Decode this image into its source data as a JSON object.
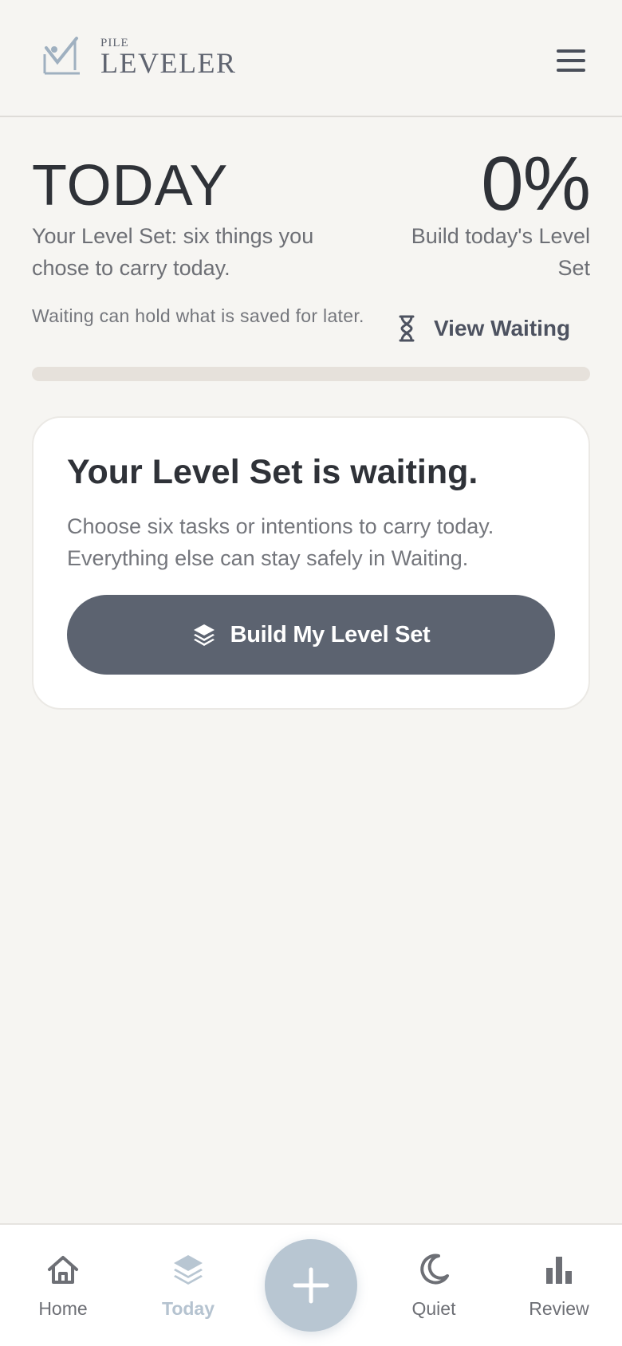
{
  "header": {
    "logo_small": "PILE",
    "logo_big": "LEVELER",
    "logo_icon": "checkmark-pile-icon",
    "menu_icon": "hamburger-menu-icon"
  },
  "today": {
    "title": "TODAY",
    "subtitle": "Your Level Set: six things you chose to carry today.",
    "percent": "0%",
    "percent_caption": "Build today's Level Set",
    "waiting_note": "Waiting can hold what is saved for later.",
    "view_waiting_label": "View Waiting",
    "view_waiting_icon": "hourglass-icon",
    "progress": 0
  },
  "card": {
    "title": "Your Level Set is waiting.",
    "body": "Choose six tasks or intentions to carry today. Everything else can stay safely in Waiting.",
    "button_label": "Build My Level Set",
    "button_icon": "layers-icon"
  },
  "nav": {
    "items": [
      {
        "label": "Home",
        "icon": "home-icon"
      },
      {
        "label": "Today",
        "icon": "layers-icon"
      },
      {
        "label": "Quiet",
        "icon": "moon-icon"
      },
      {
        "label": "Review",
        "icon": "bar-chart-icon"
      }
    ],
    "active": "Today",
    "fab_icon": "plus-icon"
  },
  "colors": {
    "background": "#f6f5f2",
    "primary": "#5c6370",
    "accent_light": "#b8c6d2",
    "track": "#e6e1db"
  }
}
